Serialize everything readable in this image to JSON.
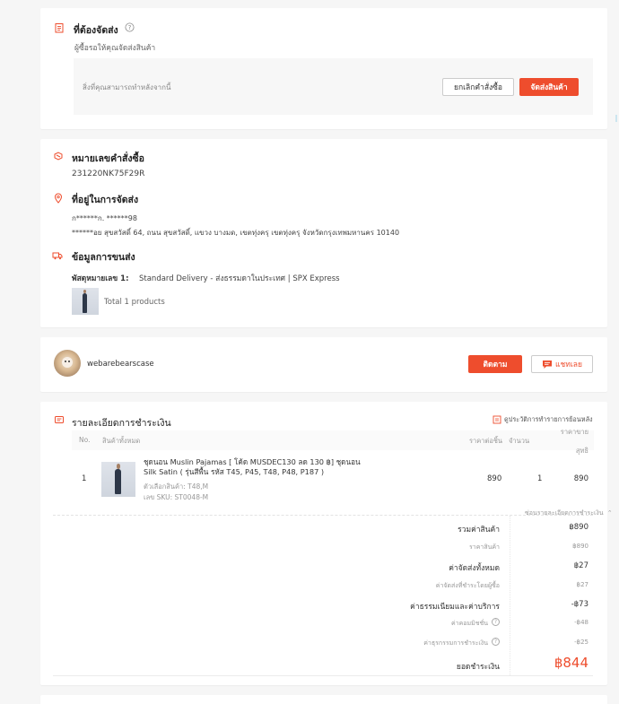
{
  "to_ship": {
    "title": "ที่ต้องจัดส่ง",
    "help_icon": "question-circle-icon",
    "subtitle": "ผู้ซื้อรอให้คุณจัดส่งสินค้า",
    "hint": "สิ่งที่คุณสามารถทำหลังจากนี้",
    "cancel_label": "ยกเลิกคำสั่งซื้อ",
    "ship_label": "จัดส่งสินค้า"
  },
  "order": {
    "order_no_title": "หมายเลขคำสั่งซื้อ",
    "order_no": "231220NK75F29R",
    "address_title": "ที่อยู่ในการจัดส่ง",
    "recipient": "ก******ก. ******98",
    "address": "******อย สุขสวัสดิ์ 64, ถนน สุขสวัสดิ์, แขวง บางมด, เขตทุ่งครุ เขตทุ่งครุ จังหวัดกรุงเทพมหานคร 10140",
    "shipping_title": "ข้อมูลการขนส่ง",
    "parcel_label": "พัสดุหมายเลข 1:",
    "parcel_info": "Standard Delivery - ส่งธรรมดาในประเทศ | SPX Express",
    "total_products": "Total 1 products"
  },
  "buyer": {
    "username": "webarebearscase",
    "follow_label": "ติดตาม",
    "chat_label": "แชทเลย"
  },
  "payment": {
    "title": "รายละเอียดการชำระเงิน",
    "history_link": "ดูประวัติการทำรายการย้อนหลัง",
    "columns": {
      "no": "No.",
      "product": "สินค้าทั้งหมด",
      "unit_price": "ราคาต่อชิ้น",
      "qty": "จำนวน",
      "subtotal_1": "ราคาขาย",
      "subtotal_2": "สุทธิ"
    },
    "item": {
      "no": "1",
      "name_1": "ชุดนอน Muslin Pajamas [ โค้ด MUSDEC130 ลด 130 ฿] ชุดนอน",
      "name_2": "Silk Satin ( รุ่นสีพื้น รหัส T45, P45, T48, P48, P187 )",
      "variation": "ตัวเลือกสินค้า: T48,M",
      "sku": "เลข SKU: ST0048-M",
      "unit_price": "890",
      "qty": "1",
      "subtotal": "890"
    },
    "toggle_label": "ซ่อนรายละเอียดการชำระเงิน",
    "summary": [
      {
        "label": "รวมค่าสินค้า",
        "value": "฿890",
        "level": "main"
      },
      {
        "label": "ราคาสินค้า",
        "value": "฿890",
        "level": "sub"
      },
      {
        "label": "ค่าจัดส่งทั้งหมด",
        "value": "฿27",
        "level": "main"
      },
      {
        "label": "ค่าจัดส่งที่ชำระโดยผู้ซื้อ",
        "value": "฿27",
        "level": "sub"
      },
      {
        "label": "ค่าธรรมเนียมและค่าบริการ",
        "value": "-฿73",
        "level": "main"
      },
      {
        "label": "ค่าคอมมิชชั่น",
        "value": "-฿48",
        "level": "sub"
      },
      {
        "label": "ค่าธุรกรรมการชำระเงิน",
        "value": "-฿25",
        "level": "sub"
      }
    ],
    "total_label": "ยอดชำระเงิน",
    "total_value": "฿844"
  },
  "colors": {
    "accent": "#ee4d2d",
    "background": "#f6f6f6"
  }
}
